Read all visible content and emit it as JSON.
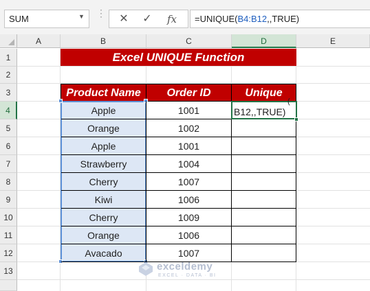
{
  "formula_bar": {
    "name_box": "SUM",
    "formula_prefix": "=UNIQUE(",
    "formula_ref": "B4:B12",
    "formula_suffix": ",,TRUE)",
    "cancel_symbol": "✕",
    "enter_symbol": "✓",
    "fx_symbol": "fx"
  },
  "columns": [
    "A",
    "B",
    "C",
    "D",
    "E"
  ],
  "rows": [
    "1",
    "2",
    "3",
    "4",
    "5",
    "6",
    "7",
    "8",
    "9",
    "10",
    "11",
    "12",
    "13"
  ],
  "sheet": {
    "title": "Excel UNIQUE Function",
    "headers": {
      "product": "Product Name",
      "order": "Order ID",
      "unique": "Unique"
    },
    "data": [
      {
        "product": "Apple",
        "order": "1001"
      },
      {
        "product": "Orange",
        "order": "1002"
      },
      {
        "product": "Apple",
        "order": "1001"
      },
      {
        "product": "Strawberry",
        "order": "1004"
      },
      {
        "product": "Cherry",
        "order": "1007"
      },
      {
        "product": "Kiwi",
        "order": "1006"
      },
      {
        "product": "Cherry",
        "order": "1009"
      },
      {
        "product": "Orange",
        "order": "1006"
      },
      {
        "product": "Avacado",
        "order": "1007"
      }
    ],
    "active_cell_text": "B12,,TRUE)",
    "active_cell_overflow": "(",
    "header_color": "#c00000"
  },
  "watermark": {
    "name": "exceldemy",
    "tagline": "EXCEL · DATA · BI"
  }
}
